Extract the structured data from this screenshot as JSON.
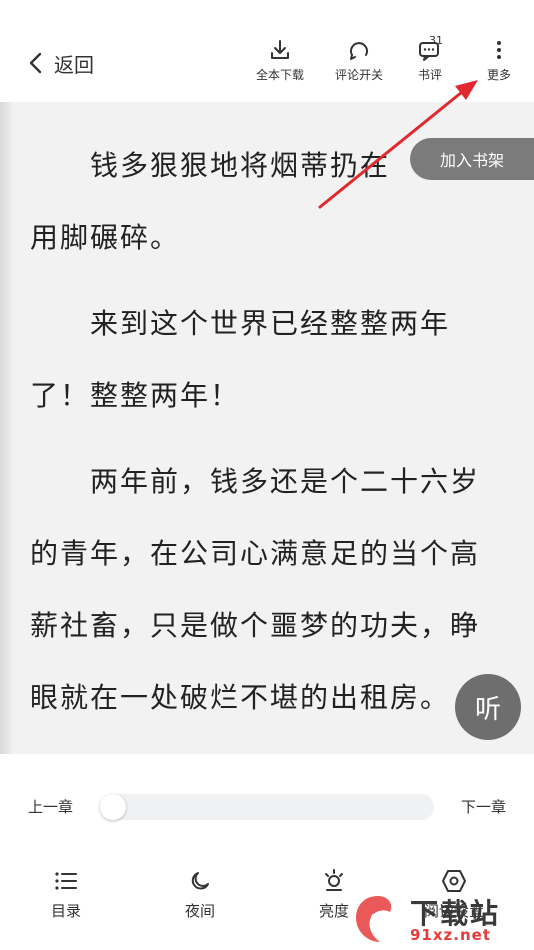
{
  "header": {
    "back_label": "返回",
    "tools": [
      {
        "label": "全本下载",
        "icon": "download-icon"
      },
      {
        "label": "评论开关",
        "icon": "comment-toggle-icon"
      },
      {
        "label": "书评",
        "icon": "book-review-icon",
        "badge": "31"
      },
      {
        "label": "更多",
        "icon": "more-vertical-icon"
      }
    ]
  },
  "reader": {
    "add_to_shelf": "加入书架",
    "listen": "听",
    "paragraphs": [
      "钱多狠狠地将烟蒂扔在地上，用脚碾碎。",
      "来到这个世界已经整整两年了！整整两年！",
      "两年前，钱多还是个二十六岁的青年，在公司心满意足的当个高薪社畜，只是做个噩梦的功夫，睁眼就在一处破烂不堪的出租房。"
    ],
    "lines": [
      "钱多狠狠地将烟蒂扔在",
      "用脚碾碎。",
      "来到这个世界已经整整两年",
      "了！整整两年！",
      "两年前，钱多还是个二十六岁",
      "的青年，在公司心满意足的当个高",
      "薪社畜，只是做个噩梦的功夫，睁",
      "眼就在一处破烂不堪的出租房。"
    ]
  },
  "progress": {
    "prev_label": "上一章",
    "next_label": "下一章",
    "value": 0
  },
  "bottom_nav": [
    {
      "label": "目录",
      "icon": "list-icon"
    },
    {
      "label": "夜间",
      "icon": "moon-icon"
    },
    {
      "label": "亮度",
      "icon": "brightness-icon"
    },
    {
      "label": "阅读设置",
      "icon": "settings-hexagon-icon"
    }
  ],
  "watermark": {
    "big": "下载站",
    "small": "91xz.net"
  },
  "colors": {
    "reader_bg": "#f2f2f2",
    "shelf_bg": "#7b7b7b",
    "annotation_arrow": "#e0282e"
  }
}
